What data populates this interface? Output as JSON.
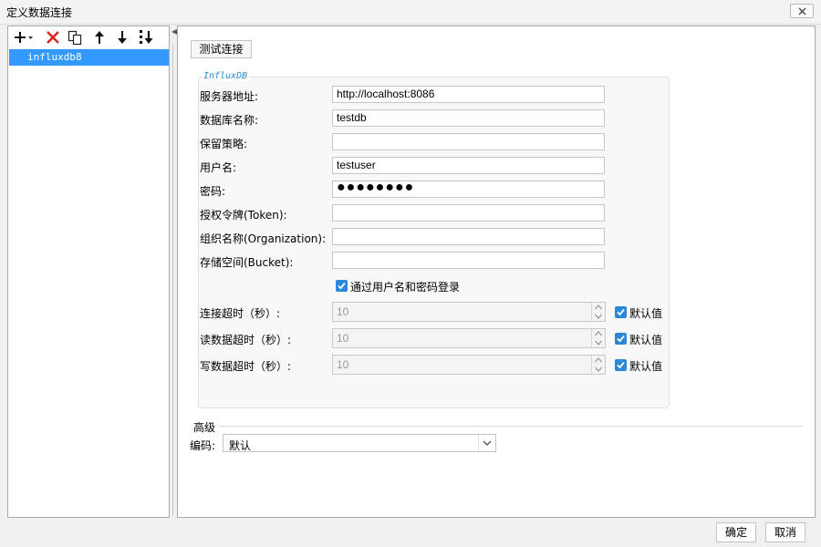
{
  "window": {
    "title": "定义数据连接"
  },
  "toolbar": {
    "icons": [
      "add-dropdown-icon",
      "delete-icon",
      "copy-icon",
      "move-up-icon",
      "move-down-icon",
      "sort-icon"
    ]
  },
  "connections": [
    {
      "name": "influxdb8",
      "selected": true
    }
  ],
  "test_button": "测试连接",
  "group_title": "InfluxDB",
  "fields": {
    "server": {
      "label": "服务器地址:",
      "value": "http://localhost:8086"
    },
    "database": {
      "label": "数据库名称:",
      "value": "testdb"
    },
    "retention": {
      "label": "保留策略:",
      "value": ""
    },
    "username": {
      "label": "用户名:",
      "value": "testuser"
    },
    "password": {
      "label": "密码:",
      "value": "●●●●●●●●"
    },
    "token": {
      "label": "授权令牌(Token):",
      "value": ""
    },
    "organization": {
      "label": "组织名称(Organization):",
      "value": ""
    },
    "bucket": {
      "label": "存储空间(Bucket):",
      "value": ""
    }
  },
  "login_checkbox": {
    "label": "通过用户名和密码登录",
    "checked": true
  },
  "timeouts": {
    "connect": {
      "label": "连接超时（秒）:",
      "value": "10",
      "default_label": "默认值",
      "default_checked": true
    },
    "read": {
      "label": "读数据超时（秒）:",
      "value": "10",
      "default_label": "默认值",
      "default_checked": true
    },
    "write": {
      "label": "写数据超时（秒）:",
      "value": "10",
      "default_label": "默认值",
      "default_checked": true
    }
  },
  "advanced": {
    "title": "高级",
    "encoding_label": "编码:",
    "encoding_value": "默认"
  },
  "footer": {
    "ok": "确定",
    "cancel": "取消"
  },
  "colors": {
    "selection": "#3399ff",
    "checkbox": "#2b87d8",
    "group_title": "#2a8bd6",
    "delete": "#e02020"
  }
}
